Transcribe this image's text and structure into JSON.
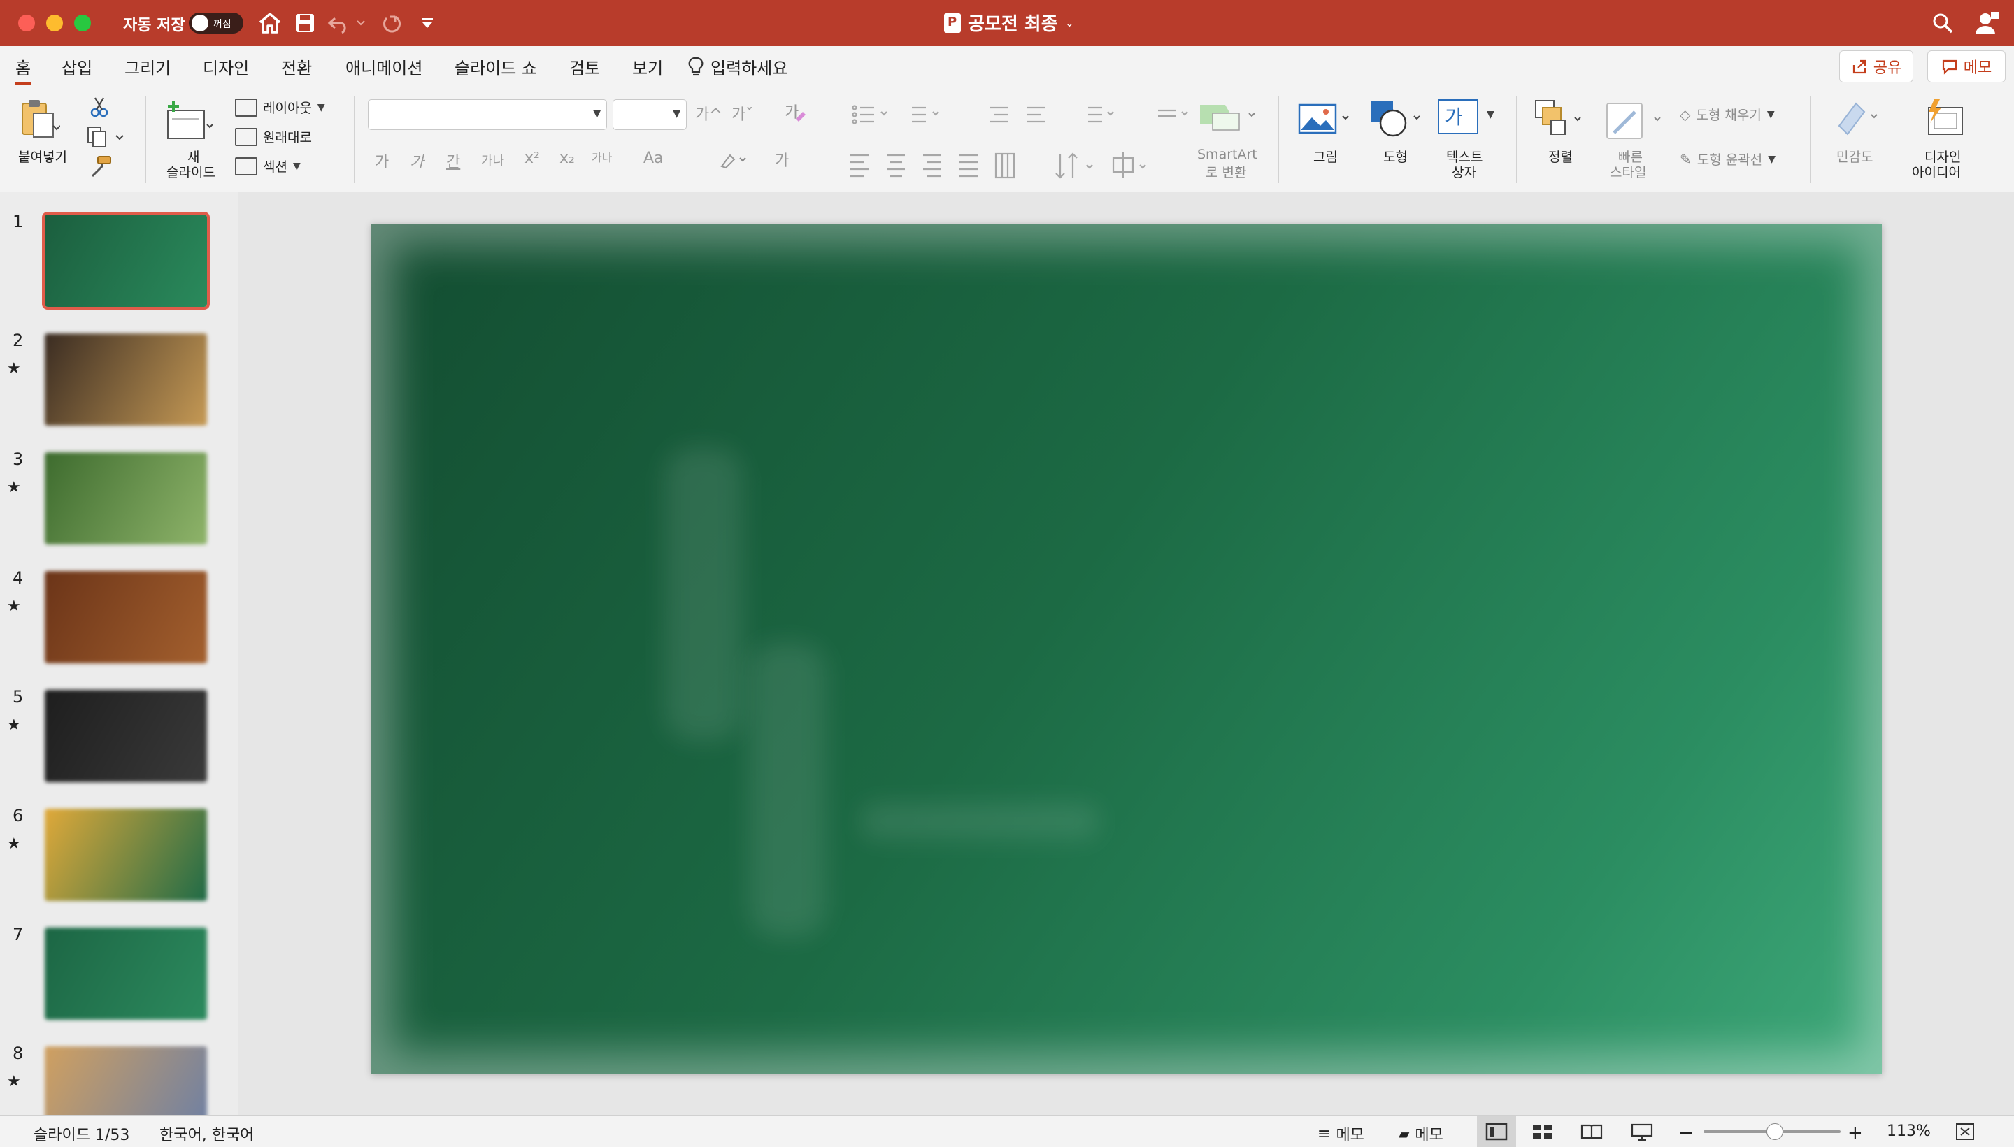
{
  "titlebar": {
    "autosave_label": "자동 저장",
    "autosave_state": "꺼짐",
    "document_title": "공모전 최종",
    "icons": [
      "home-icon",
      "save-icon",
      "undo-icon",
      "redo-icon",
      "customize-icon",
      "search-icon",
      "account-icon"
    ]
  },
  "tabs": [
    "홈",
    "삽입",
    "그리기",
    "디자인",
    "전환",
    "애니메이션",
    "슬라이드 쇼",
    "검토",
    "보기"
  ],
  "active_tab": "홈",
  "tell_me": "입력하세요",
  "share_label": "공유",
  "comments_label": "메모",
  "ribbon": {
    "paste": "붙여넣기",
    "new_slide_1": "새",
    "new_slide_2": "슬라이드",
    "layout": "레이아웃",
    "reset": "원래대로",
    "section": "섹션",
    "smartart_1": "SmartArt",
    "smartart_2": "로 변환",
    "picture": "그림",
    "shapes": "도형",
    "textbox_1": "텍스트",
    "textbox_2": "상자",
    "textbox_glyph": "가",
    "arrange": "정렬",
    "quick_styles_1": "빠른",
    "quick_styles_2": "스타일",
    "shape_fill": "도형 채우기",
    "shape_outline": "도형 윤곽선",
    "sensitivity": "민감도",
    "designer_1": "디자인",
    "designer_2": "아이디어",
    "font_glyphs": {
      "grow": "가^",
      "shrink": "가ˇ",
      "bold": "가",
      "italic": "가",
      "underline": "간",
      "strike": "가나",
      "superscript": "x²",
      "subscript": "x₂",
      "spacing": "가나",
      "case": "Aa",
      "color": "가"
    }
  },
  "slides": [
    {
      "num": "1",
      "star": false,
      "colors": [
        "#1b5e3e",
        "#2a8a5c"
      ]
    },
    {
      "num": "2",
      "star": true,
      "colors": [
        "#3a2c22",
        "#c69a55"
      ]
    },
    {
      "num": "3",
      "star": true,
      "colors": [
        "#3d6b2e",
        "#8fb46a"
      ]
    },
    {
      "num": "4",
      "star": true,
      "colors": [
        "#6b3418",
        "#a4602e"
      ]
    },
    {
      "num": "5",
      "star": true,
      "colors": [
        "#1e1e1e",
        "#3a3a3a"
      ]
    },
    {
      "num": "6",
      "star": true,
      "colors": [
        "#e0a93a",
        "#1f6b47"
      ]
    },
    {
      "num": "7",
      "star": false,
      "colors": [
        "#1c6644",
        "#2c8a5e"
      ]
    },
    {
      "num": "8",
      "star": true,
      "colors": [
        "#d0a060",
        "#6c7fa5"
      ]
    }
  ],
  "star_glyph": "★",
  "status": {
    "slide_info": "슬라이드 1/53",
    "language": "한국어, 한국어",
    "notes": "메모",
    "comments": "메모",
    "zoom": "113%"
  }
}
